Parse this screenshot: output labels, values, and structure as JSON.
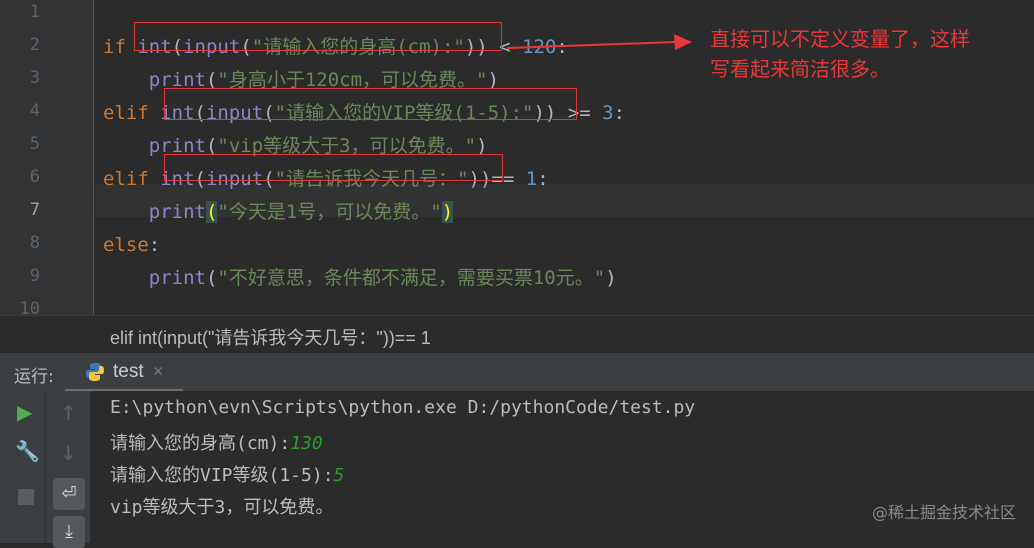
{
  "editor": {
    "line_numbers": [
      "1",
      "2",
      "3",
      "4",
      "5",
      "6",
      "7",
      "8",
      "9",
      "10"
    ],
    "current_line": "7",
    "lines": [
      [],
      [
        [
          "kw",
          "if "
        ],
        [
          "fn",
          "int"
        ],
        [
          "",
          "("
        ],
        [
          "fn",
          "input"
        ],
        [
          "",
          "("
        ],
        [
          "str",
          "\"请输入您的身高(cm):\""
        ],
        [
          "",
          "))"
        ],
        [
          "",
          " < "
        ],
        [
          "num",
          "120"
        ],
        [
          "",
          ":"
        ]
      ],
      [
        [
          "",
          "    "
        ],
        [
          "fn",
          "print"
        ],
        [
          "",
          "("
        ],
        [
          "str",
          "\"身高小于120cm，可以免费。\""
        ],
        [
          "",
          ")"
        ]
      ],
      [
        [
          "kw",
          "elif "
        ],
        [
          "fn",
          "int"
        ],
        [
          "",
          "("
        ],
        [
          "fn",
          "input"
        ],
        [
          "",
          "("
        ],
        [
          "str",
          "\"请输入您的VIP等级(1-5):\""
        ],
        [
          "",
          "))"
        ],
        [
          "",
          " >= "
        ],
        [
          "num",
          "3"
        ],
        [
          "",
          ":"
        ]
      ],
      [
        [
          "",
          "    "
        ],
        [
          "fn",
          "print"
        ],
        [
          "",
          "("
        ],
        [
          "str",
          "\"vip等级大于3，可以免费。\""
        ],
        [
          "",
          ")"
        ]
      ],
      [
        [
          "kw",
          "elif "
        ],
        [
          "fn",
          "int"
        ],
        [
          "",
          "("
        ],
        [
          "fn",
          "input"
        ],
        [
          "",
          "("
        ],
        [
          "str",
          "\"请告诉我今天几号：\""
        ],
        [
          "",
          "))"
        ],
        [
          "",
          "== "
        ],
        [
          "num",
          "1"
        ],
        [
          "",
          ":"
        ]
      ],
      [
        [
          "",
          "    "
        ],
        [
          "fn",
          "print"
        ],
        [
          "hl",
          "("
        ],
        [
          "str",
          "\"今天是1号，可以免费。\""
        ],
        [
          "hl",
          ")"
        ]
      ],
      [
        [
          "kw",
          "else"
        ],
        [
          "",
          ":"
        ]
      ],
      [
        [
          "",
          "    "
        ],
        [
          "fn",
          "print"
        ],
        [
          "",
          "("
        ],
        [
          "str",
          "\"不好意思，条件都不满足，需要买票10元。\""
        ],
        [
          "",
          ")"
        ]
      ],
      []
    ]
  },
  "annotation": {
    "line1": "直接可以不定义变量了，这样",
    "line2": "写看起来简洁很多。",
    "color": "#e8373a"
  },
  "breadcrumb": "elif int(input(\"请告诉我今天几号：\"))== 1",
  "run_panel": {
    "label": "运行:",
    "tab_label": "test",
    "console": [
      {
        "text": "E:\\python\\evn\\Scripts\\python.exe D:/pythonCode/test.py",
        "input": ""
      },
      {
        "text": "请输入您的身高(cm):",
        "input": "130"
      },
      {
        "text": "请输入您的VIP等级(1-5):",
        "input": "5"
      },
      {
        "text": "vip等级大于3，可以免费。",
        "input": ""
      }
    ]
  },
  "watermark": "@稀土掘金技术社区"
}
